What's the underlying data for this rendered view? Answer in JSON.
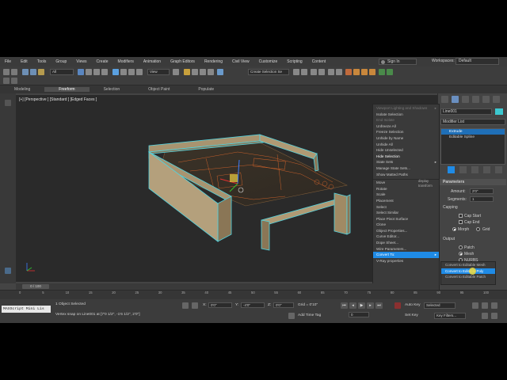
{
  "menu": [
    "File",
    "Edit",
    "Tools",
    "Group",
    "Views",
    "Create",
    "Modifiers",
    "Animation",
    "Graph Editors",
    "Rendering",
    "Civil View",
    "Customize",
    "Scripting",
    "Content"
  ],
  "account": {
    "sign_in": "Sign In",
    "workspaces_label": "Workspaces:",
    "workspace": "Default"
  },
  "toolbar": {
    "filter": "All",
    "view": "View",
    "selection_set": "Create Selection Se"
  },
  "ribbon": {
    "tabs": [
      "Modeling",
      "Freeform",
      "Selection",
      "Object Paint",
      "Populate"
    ],
    "active": "Freeform"
  },
  "viewport": {
    "label": "[+] [Perspective ] [Standard ] [Edged Faces ]",
    "axis": "X Y Z"
  },
  "quad_menu": [
    {
      "label": "Viewport Lighting and Shadows",
      "style": "dim",
      "arrow": true
    },
    {
      "label": "Isolate Selection"
    },
    {
      "label": "End Isolate",
      "style": "dim"
    },
    {
      "label": "Unfreeze All"
    },
    {
      "label": "Freeze Selection"
    },
    {
      "label": "Unhide by Name"
    },
    {
      "label": "Unhide All"
    },
    {
      "label": "Hide Unselected"
    },
    {
      "label": "Hide Selection",
      "style": "bold"
    },
    {
      "label": "State Sets",
      "arrow": true
    },
    {
      "label": "Manage State Sets..."
    },
    {
      "label": "Show Matted Paths"
    },
    {
      "sep": true,
      "label": ""
    },
    {
      "label": "Move"
    },
    {
      "label": "Rotate"
    },
    {
      "label": "Scale"
    },
    {
      "label": "Placement"
    },
    {
      "label": "Select"
    },
    {
      "label": "Select Similar"
    },
    {
      "label": "Place Pivot Surface"
    },
    {
      "label": "Clone"
    },
    {
      "label": "Object Properties..."
    },
    {
      "label": "Curve Editor..."
    },
    {
      "label": "Dope Sheet..."
    },
    {
      "label": "Wire Parameters..."
    },
    {
      "label": "Convert To:",
      "style": "hi",
      "arrow": true
    },
    {
      "label": "V-Ray properties"
    }
  ],
  "quad_menu_side": {
    "display": "display",
    "transform": "transform"
  },
  "command_panel": {
    "object_name": "Line001",
    "modifier_list": "Modifier List",
    "stack": [
      {
        "label": "Extrude",
        "selected": true
      },
      {
        "label": "Editable Spline",
        "selected": false
      }
    ],
    "params_title": "Parameters",
    "amount_label": "Amount:",
    "amount": "2'0\"",
    "segments_label": "Segments:",
    "segments": "1",
    "capping_title": "Capping",
    "cap_start": "Cap Start",
    "cap_end": "Cap End",
    "morph": "Morph",
    "grid": "Grid",
    "output_title": "Output",
    "patch": "Patch",
    "mesh": "Mesh",
    "nurbs": "NURBS",
    "color": "#3cc8d0"
  },
  "convert_submenu": [
    {
      "label": "Convert to Editable Mesh",
      "hi": false
    },
    {
      "label": "Convert to Editable Poly",
      "hi": true
    },
    {
      "label": "Convert to Editable Patch",
      "hi": false
    }
  ],
  "timeline": {
    "position": "0 / 100",
    "ticks": [
      "0",
      "5",
      "10",
      "15",
      "20",
      "25",
      "30",
      "35",
      "40",
      "45",
      "50",
      "55",
      "60",
      "65",
      "70",
      "75",
      "80",
      "85",
      "90",
      "95",
      "100"
    ]
  },
  "status": {
    "selected": "1 Object Selected",
    "prompt": "Vertex snap on Line001 at [7'0 1/2\", -1'6 1/2\", 2'0\"]",
    "maxscript": "MAXScript Mini Lis",
    "x_label": "X:",
    "x": "0'0\"",
    "y_label": "Y:",
    "y": "-4'0\"",
    "z_label": "Z:",
    "z": "0'0\"",
    "grid": "Grid = 0'10\"",
    "add_time_tag": "Add Time Tag",
    "auto_key": "Auto Key",
    "set_key": "Set Key",
    "key_mode": "Selected",
    "key_filters": "Key Filters...",
    "frame": "0"
  }
}
